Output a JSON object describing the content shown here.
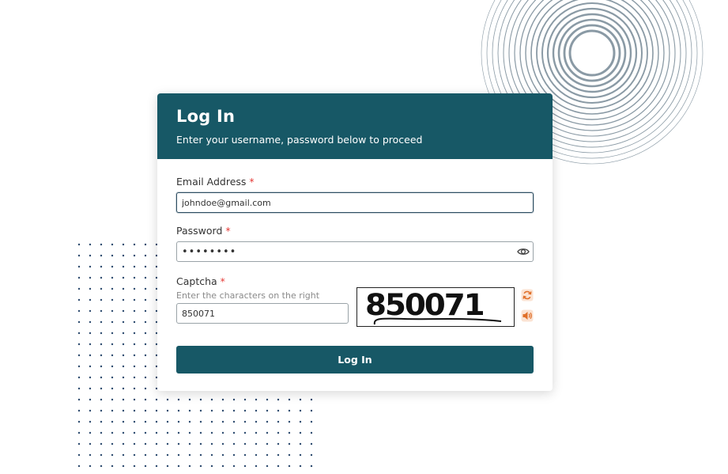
{
  "header": {
    "title": "Log In",
    "subtitle": "Enter your username, password below to proceed"
  },
  "form": {
    "email": {
      "label": "Email Address",
      "required_mark": "*",
      "value": "johndoe@gmail.com"
    },
    "password": {
      "label": "Password",
      "required_mark": "*",
      "value": "••••••••",
      "toggle_icon": "eye-icon"
    },
    "captcha": {
      "label": "Captcha",
      "required_mark": "*",
      "hint": "Enter the characters on the right",
      "value": "850071",
      "image_text": "850071",
      "refresh_icon": "refresh-icon",
      "audio_icon": "speaker-icon"
    },
    "submit_label": "Log In"
  },
  "colors": {
    "primary": "#175866",
    "required": "#e53935",
    "icon_accent": "#e0702a",
    "decoration": "#8a9aa5"
  }
}
